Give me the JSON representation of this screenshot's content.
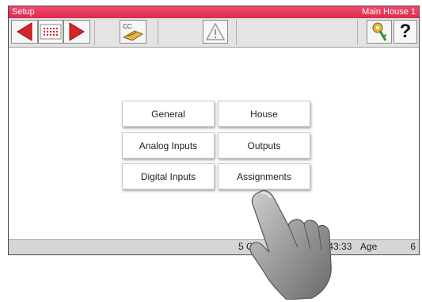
{
  "titlebar": {
    "title": "Setup",
    "location": "Main House 1"
  },
  "toolbar": {
    "buttons": [
      {
        "name": "back-arrow-icon",
        "color": "#d8232a"
      },
      {
        "name": "list-icon"
      },
      {
        "name": "forward-arrow-icon",
        "color": "#d8232a"
      },
      {
        "name": "cc-hand-icon",
        "label": "CC"
      },
      {
        "name": "warning-triangle-icon"
      },
      {
        "name": "key-icon"
      },
      {
        "name": "help-icon",
        "label": "?"
      }
    ]
  },
  "menu": {
    "general": "General",
    "house": "House",
    "analog_inputs": "Analog Inputs",
    "outputs": "Outputs",
    "digital_inputs": "Digital Inputs",
    "assignments": "Assignments"
  },
  "status": {
    "left": "5 C",
    "time": ":43:33",
    "age_label": "Age",
    "age_value": "6"
  },
  "colors": {
    "titlebar": "#e8375c",
    "arrow": "#d8232a"
  }
}
